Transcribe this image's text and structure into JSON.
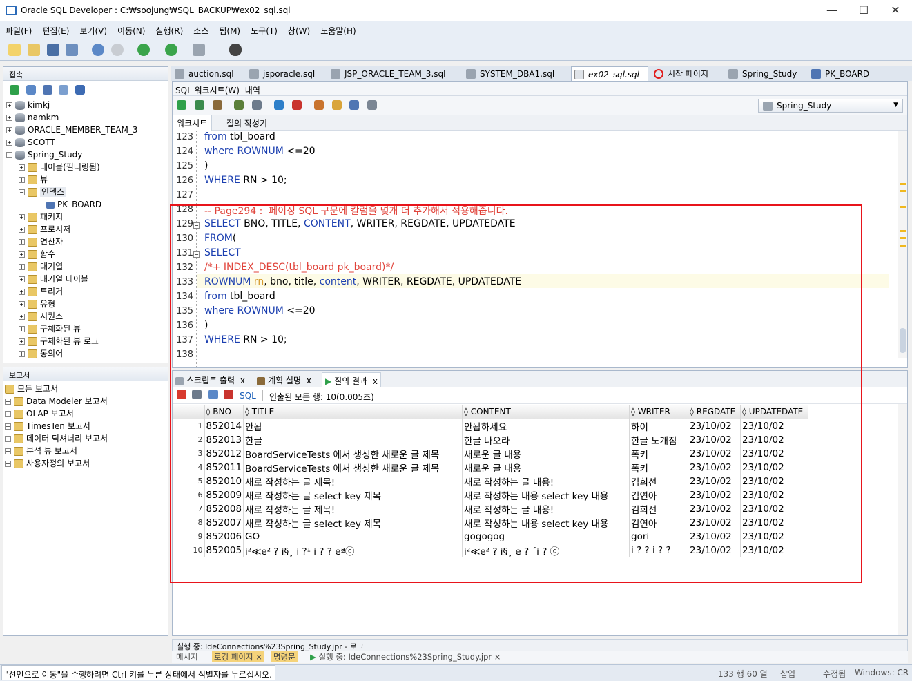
{
  "window": {
    "title": "Oracle SQL Developer : C:₩soojung₩SQL_BACKUP₩ex02_sql.sql",
    "minimize": "—",
    "maximize": "☐",
    "close": "✕"
  },
  "menu": [
    "파일(F)",
    "편집(E)",
    "보기(V)",
    "이동(N)",
    "실행(R)",
    "소스",
    "팀(M)",
    "도구(T)",
    "창(W)",
    "도움말(H)"
  ],
  "connections": {
    "title": "접속",
    "items": [
      "kimkj",
      "namkm",
      "ORACLE_MEMBER_TEAM_3",
      "SCOTT",
      "Spring_Study"
    ],
    "children": [
      "테이블(필터링됨)",
      "뷰",
      "인덱스",
      "PK_BOARD",
      "패키지",
      "프로시저",
      "연산자",
      "함수",
      "대기열",
      "대기열 테이블",
      "트리거",
      "유형",
      "시퀀스",
      "구체화된 뷰",
      "구체화된 뷰 로그",
      "동의어"
    ]
  },
  "reports": {
    "title": "보고서",
    "items": [
      "모든 보고서",
      "Data Modeler 보고서",
      "OLAP 보고서",
      "TimesTen 보고서",
      "데이터 딕셔너리 보고서",
      "분석 뷰 보고서",
      "사용자정의 보고서"
    ]
  },
  "tabs": [
    "auction.sql",
    "jsporacle.sql",
    "JSP_ORACLE_TEAM_3.sql",
    "SYSTEM_DBA1.sql",
    "ex02_sql.sql",
    "시작 페이지",
    "Spring_Study",
    "PK_BOARD"
  ],
  "subtabs": {
    "worksheet": "SQL 워크시트(W)",
    "history": "내역",
    "ws": "워크시트",
    "qb": "질의 작성기"
  },
  "connection_select": "Spring_Study",
  "editor_lines": [
    {
      "n": "123",
      "t": [
        [
          "kw",
          "from"
        ],
        [
          "",
          " tbl_board"
        ]
      ]
    },
    {
      "n": "124",
      "t": [
        [
          "kw",
          "where ROWNUM"
        ],
        [
          "",
          " <=20"
        ]
      ]
    },
    {
      "n": "125",
      "t": [
        [
          "",
          ")"
        ]
      ]
    },
    {
      "n": "126",
      "t": [
        [
          "kw",
          "WHERE"
        ],
        [
          "",
          " RN > 10;"
        ]
      ]
    },
    {
      "n": "127",
      "t": []
    },
    {
      "n": "128",
      "t": [
        [
          "cm",
          "-- Page294 :  페이징 SQL 구문에 칼럼을 몇개 더 추가해서 적용해줍니다."
        ]
      ]
    },
    {
      "n": "129",
      "t": [
        [
          "kw",
          "SELECT"
        ],
        [
          "",
          " BNO, TITLE, "
        ],
        [
          "kw",
          "CONTENT"
        ],
        [
          "",
          ", WRITER, REGDATE, UPDATEDATE"
        ]
      ]
    },
    {
      "n": "130",
      "t": [
        [
          "kw",
          "FROM"
        ],
        [
          "",
          "("
        ]
      ]
    },
    {
      "n": "131",
      "t": [
        [
          "kw",
          "SELECT"
        ]
      ]
    },
    {
      "n": "132",
      "t": [
        [
          "cm",
          "/*+ INDEX_DESC(tbl_board pk_board)*/"
        ]
      ]
    },
    {
      "n": "133",
      "t": [
        [
          "kw",
          "ROWNUM"
        ],
        [
          "",
          " "
        ],
        [
          "fn",
          "rn"
        ],
        [
          "",
          ", bno, title, "
        ],
        [
          "kw",
          "content"
        ],
        [
          "",
          ", WRITER, REGDATE, UPDATEDATE"
        ]
      ]
    },
    {
      "n": "134",
      "t": [
        [
          "kw",
          "from"
        ],
        [
          "",
          " tbl_board"
        ]
      ]
    },
    {
      "n": "135",
      "t": [
        [
          "kw",
          "where ROWNUM"
        ],
        [
          "",
          " <=20"
        ]
      ]
    },
    {
      "n": "136",
      "t": [
        [
          "",
          ")"
        ]
      ]
    },
    {
      "n": "137",
      "t": [
        [
          "kw",
          "WHERE"
        ],
        [
          "",
          " RN > 10;"
        ]
      ]
    },
    {
      "n": "138",
      "t": []
    }
  ],
  "result_tabs": [
    "스크립트 출력",
    "계획 설명",
    "질의 결과"
  ],
  "result_info": "인출된 모든 행: 10(0.005초)",
  "sql_label": "SQL",
  "columns": [
    "BNO",
    "TITLE",
    "CONTENT",
    "WRITER",
    "REGDATE",
    "UPDATEDATE"
  ],
  "rows": [
    [
      "1",
      "852014",
      "안놥",
      "안놥하세요",
      "하이",
      "23/10/02",
      "23/10/02"
    ],
    [
      "2",
      "852013",
      "한글",
      "한글 나오라",
      "한글 노개짐",
      "23/10/02",
      "23/10/02"
    ],
    [
      "3",
      "852012",
      "BoardServiceTests 에서 생성한 새로운 글 제목",
      "새로운 글 내용",
      "폭키",
      "23/10/02",
      "23/10/02"
    ],
    [
      "4",
      "852011",
      "BoardServiceTests 에서 생성한 새로운 글 제목",
      "새로운 글 내용",
      "폭키",
      "23/10/02",
      "23/10/02"
    ],
    [
      "5",
      "852010",
      "새로 작성하는 글 제목!",
      "새로 작성하는 글 내용!",
      "김희선",
      "23/10/02",
      "23/10/02"
    ],
    [
      "6",
      "852009",
      "새로 작성하는 글 select key 제목",
      "새로 작성하는 내용 select key 내용",
      "김연아",
      "23/10/02",
      "23/10/02"
    ],
    [
      "7",
      "852008",
      "새로 작성하는 글 제목!",
      "새로 작성하는 글 내용!",
      "김희선",
      "23/10/02",
      "23/10/02"
    ],
    [
      "8",
      "852007",
      "새로 작성하는 글 select key 제목",
      "새로 작성하는 내용 select key 내용",
      "김연아",
      "23/10/02",
      "23/10/02"
    ],
    [
      "9",
      "852006",
      "GO",
      "gogogog",
      "gori",
      "23/10/02",
      "23/10/02"
    ],
    [
      "10",
      "852005",
      "i²≪e² ? i§¸ i ?¹ i ?  ? eªⓒ",
      "i²≪e² ? i§¸ e ? ´i ? ⓒ",
      "i ?  ? i ?  ?",
      "23/10/02",
      "23/10/02"
    ]
  ],
  "log_bar": "실행 중: IdeConnections%23Spring_Study.jpr - 로그",
  "bottom_tabs": [
    "메시지",
    "로깅 페이지",
    "명령문",
    "실행 중: IdeConnections%23Spring_Study.jpr"
  ],
  "status": {
    "hint": "\"선언으로 이동\"을 수행하려면 Ctrl 키를 누른 상태에서 식별자를 누르십시오.",
    "pos": "133 행 60 열",
    "mode": "삽입",
    "modified": "수정됨",
    "eol": "Windows: CR"
  }
}
